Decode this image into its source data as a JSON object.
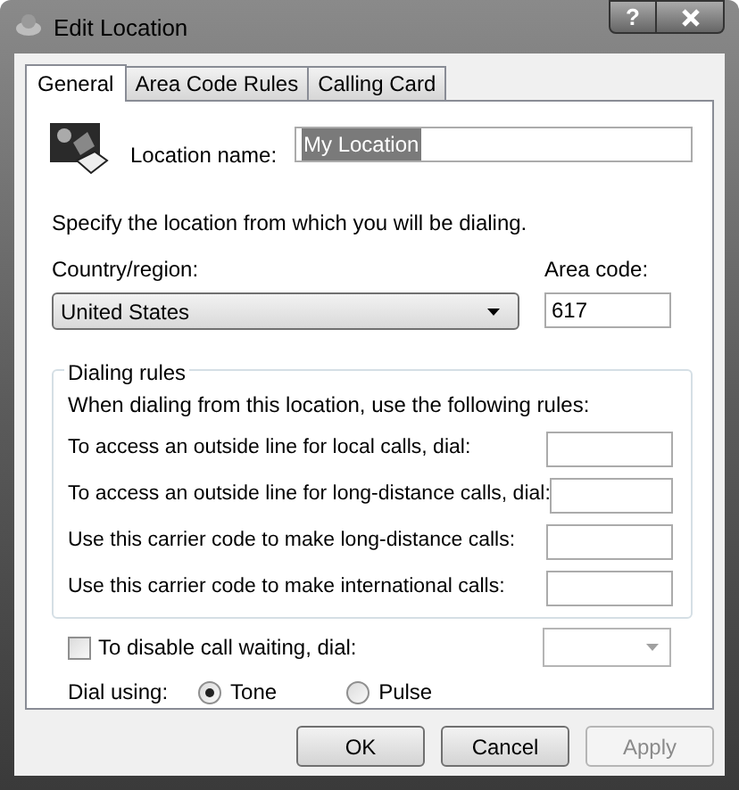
{
  "window": {
    "title": "Edit Location",
    "help": "?"
  },
  "tabs": [
    {
      "label": "General",
      "selected": true
    },
    {
      "label": "Area Code Rules",
      "selected": false
    },
    {
      "label": "Calling Card",
      "selected": false
    }
  ],
  "location_name": {
    "label": "Location name:",
    "value": "My Location",
    "text_selected": true
  },
  "instruction": "Specify the location from which you will be dialing.",
  "country": {
    "label": "Country/region:",
    "value": "United States"
  },
  "area_code": {
    "label": "Area code:",
    "value": "617"
  },
  "dialing_rules": {
    "title": "Dialing rules",
    "intro": "When dialing from this location, use the following rules:",
    "rules": [
      {
        "label": "To access an outside line for local calls, dial:"
      },
      {
        "label": "To access an outside line for long-distance calls, dial:"
      },
      {
        "label": "Use this carrier code to make long-distance calls:"
      },
      {
        "label": "Use this carrier code to make international calls:"
      }
    ]
  },
  "call_waiting": {
    "label": "To disable call waiting, dial:",
    "checked": false
  },
  "dial_using": {
    "label": "Dial using:",
    "options": [
      {
        "label": "Tone",
        "selected": true
      },
      {
        "label": "Pulse",
        "selected": false
      }
    ]
  },
  "buttons": [
    {
      "label": "OK",
      "disabled": false
    },
    {
      "label": "Cancel",
      "disabled": false
    },
    {
      "label": "Apply",
      "disabled": true
    }
  ]
}
